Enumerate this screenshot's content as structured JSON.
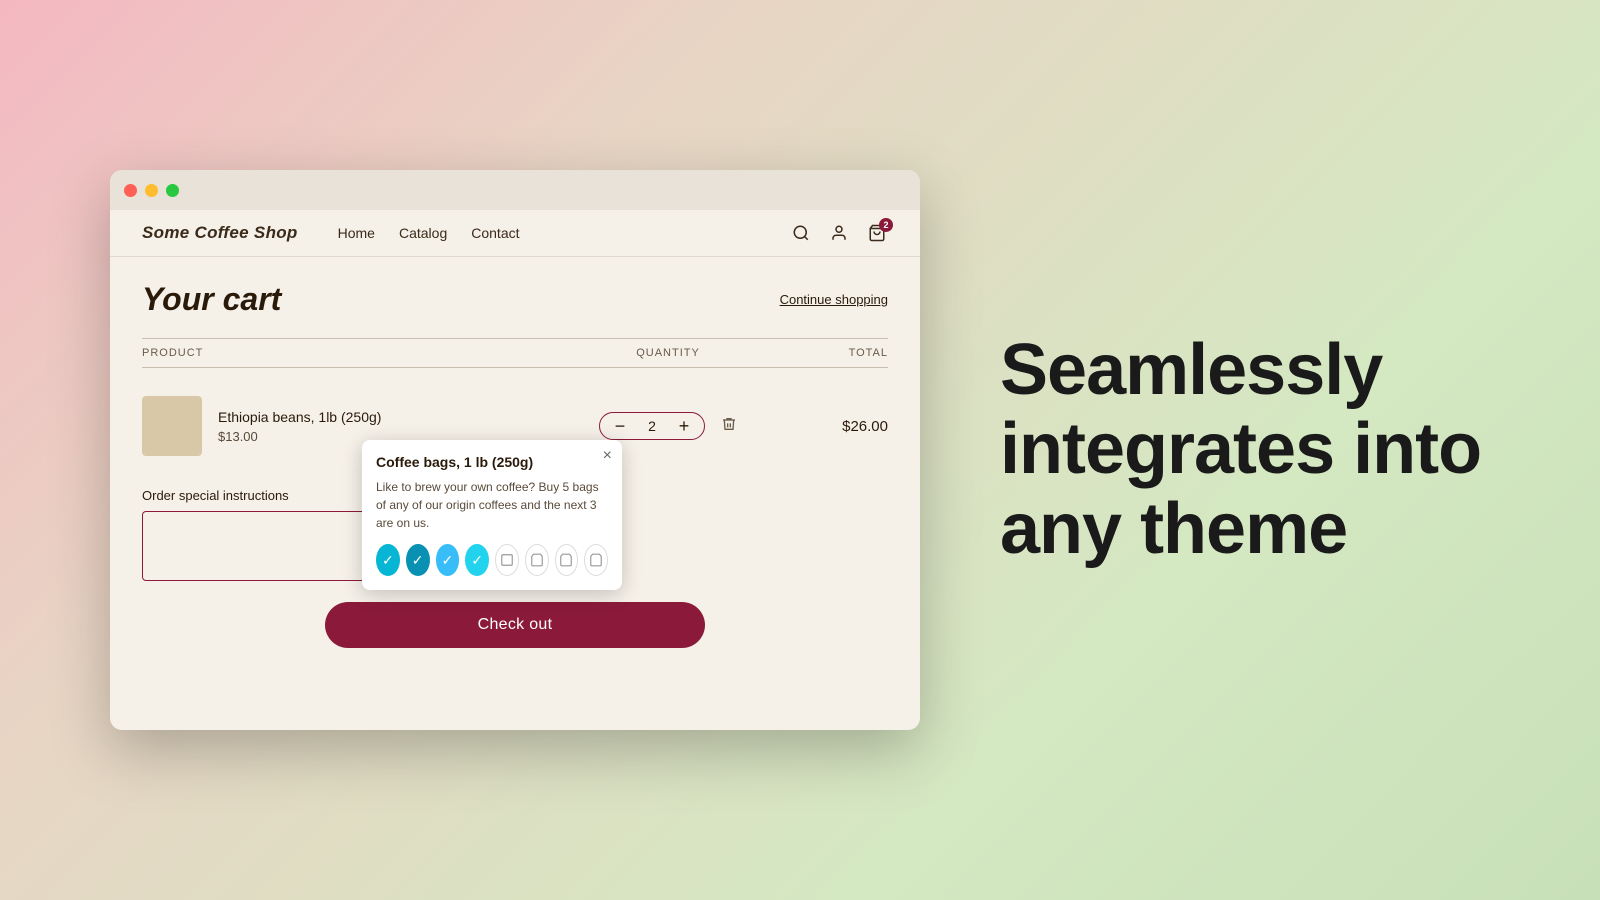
{
  "background": {
    "gradient": "linear-gradient(135deg, #f4b8c1 0%, #e8d5c4 30%, #d4e8c2 70%, #c8e0b8 100%)"
  },
  "browser": {
    "traffic_lights": [
      "red",
      "yellow",
      "green"
    ]
  },
  "nav": {
    "logo": "Some Coffee Shop",
    "links": [
      "Home",
      "Catalog",
      "Contact"
    ],
    "cart_badge": "2"
  },
  "cart": {
    "title": "Your cart",
    "continue_shopping": "Continue shopping",
    "columns": {
      "product": "PRODUCT",
      "quantity": "QUANTITY",
      "total": "TOTAL"
    },
    "item": {
      "name": "Ethiopia beans, 1lb (250g)",
      "price": "$13.00",
      "quantity": "2",
      "total": "$26.00"
    },
    "tooltip": {
      "title": "Coffee bags, 1 lb (250g)",
      "description": "Like to brew your own coffee? Buy 5 bags of any of our origin coffees and the next 3 are on us.",
      "icons": [
        {
          "type": "active-teal",
          "symbol": "✓"
        },
        {
          "type": "active-teal2",
          "symbol": "✓"
        },
        {
          "type": "active-sky",
          "symbol": "✓"
        },
        {
          "type": "active-cyan",
          "symbol": "✓"
        },
        {
          "type": "inactive",
          "symbol": "□"
        },
        {
          "type": "inactive",
          "symbol": "🛍"
        },
        {
          "type": "inactive",
          "symbol": "🛍"
        },
        {
          "type": "inactive",
          "symbol": "🛍"
        }
      ]
    },
    "instructions_label": "Order special instructions",
    "instructions_placeholder": "",
    "checkout_label": "Check out"
  },
  "tagline": {
    "line1": "Seamlessly",
    "line2": "integrates into",
    "line3": "any theme"
  }
}
